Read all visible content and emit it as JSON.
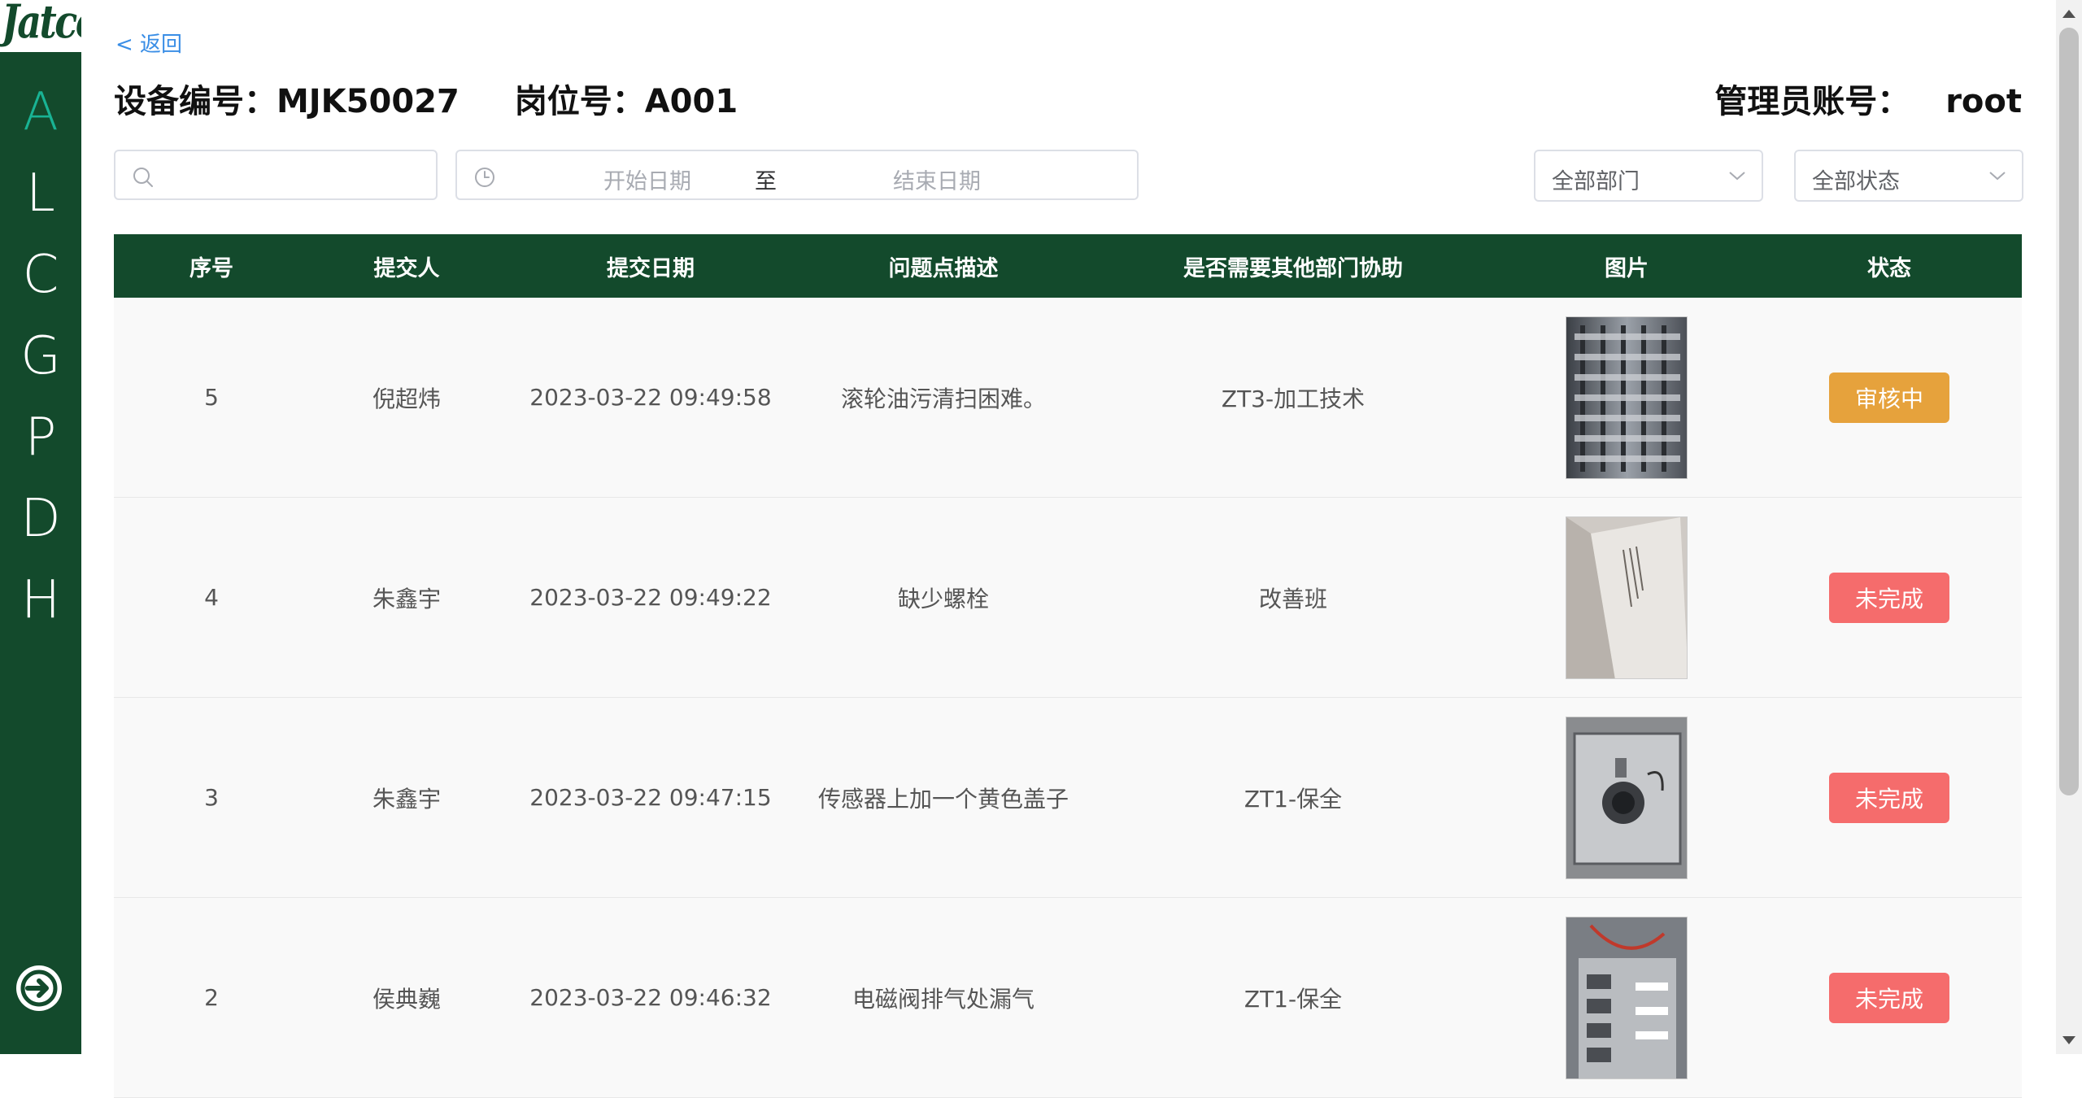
{
  "sidebar": {
    "logo": "Jatco",
    "nav_items": [
      {
        "label": "A",
        "active": true
      },
      {
        "label": "L",
        "active": false
      },
      {
        "label": "C",
        "active": false
      },
      {
        "label": "G",
        "active": false
      },
      {
        "label": "P",
        "active": false
      },
      {
        "label": "D",
        "active": false
      },
      {
        "label": "H",
        "active": false
      }
    ],
    "logout_icon": "arrow-right-circle-icon"
  },
  "header": {
    "back_label": "< 返回",
    "device_label": "设备编号：MJK50027",
    "post_label": "岗位号：A001",
    "admin_label": "管理员账号：",
    "admin_value": "root"
  },
  "filters": {
    "search": {
      "placeholder": "",
      "icon": "search-icon"
    },
    "date": {
      "start_placeholder": "开始日期",
      "separator": "至",
      "end_placeholder": "结束日期",
      "icon": "clock-icon"
    },
    "department_select": {
      "value": "全部部门"
    },
    "status_select": {
      "value": "全部状态"
    }
  },
  "table": {
    "columns": [
      "序号",
      "提交人",
      "提交日期",
      "问题点描述",
      "是否需要其他部门协助",
      "图片",
      "状态"
    ],
    "rows": [
      {
        "id": "5",
        "submitter": "倪超炜",
        "date": "2023-03-22 09:49:58",
        "description": "滚轮油污清扫困难。",
        "assist": "ZT3-加工技术",
        "status": "审核中",
        "status_color": "#e6a23c"
      },
      {
        "id": "4",
        "submitter": "朱鑫宇",
        "date": "2023-03-22 09:49:22",
        "description": "缺少螺栓",
        "assist": "改善班",
        "status": "未完成",
        "status_color": "#f56c6c"
      },
      {
        "id": "3",
        "submitter": "朱鑫宇",
        "date": "2023-03-22 09:47:15",
        "description": "传感器上加一个黄色盖子",
        "assist": "ZT1-保全",
        "status": "未完成",
        "status_color": "#f56c6c"
      },
      {
        "id": "2",
        "submitter": "侯典巍",
        "date": "2023-03-22 09:46:32",
        "description": "电磁阀排气处漏气",
        "assist": "ZT1-保全",
        "status": "未完成",
        "status_color": "#f56c6c"
      }
    ]
  },
  "colors": {
    "sidebar_bg": "#134a2c",
    "active_nav": "#19b394",
    "link": "#3a8ee6",
    "header_bg": "#134a2c"
  }
}
